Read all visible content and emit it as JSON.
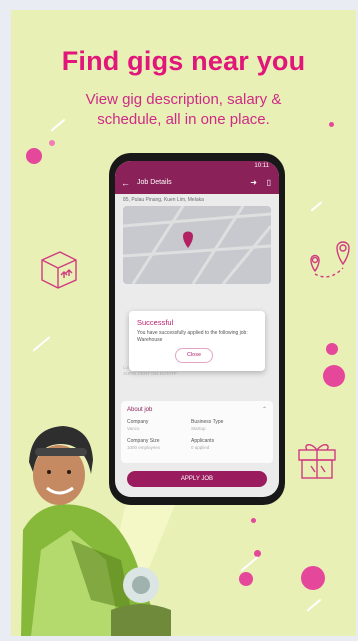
{
  "promo": {
    "headline": "Find gigs near you",
    "subline_1": "View gig description, salary &",
    "subline_2": "schedule, all in one place."
  },
  "app": {
    "status_time": "10:11",
    "screen_title": "Job Details",
    "address": "85, Pulau Pinang, Kuen Lim, Melaka",
    "modal": {
      "title": "Successful",
      "message": "You have successfully applied to the following job: Warehouse",
      "close_label": "Close"
    },
    "requirements_text": "Lorem ipsum dolor sit amet, consectetur adipiscing elit. Volutpat ligula SUPIK CENT 034 DATATP",
    "about_job": {
      "title": "About job",
      "fields": [
        {
          "label": "Company",
          "value": "Vanco"
        },
        {
          "label": "Business Type",
          "value": "Startup"
        },
        {
          "label": "Company Size",
          "value": "1000 employees"
        },
        {
          "label": "Applicants",
          "value": "0 applied"
        }
      ]
    },
    "apply_label": "APPLY JOB"
  },
  "colors": {
    "background": "#e8f0b6",
    "accent_pink": "#e1157a",
    "app_bar": "#8a2158"
  }
}
